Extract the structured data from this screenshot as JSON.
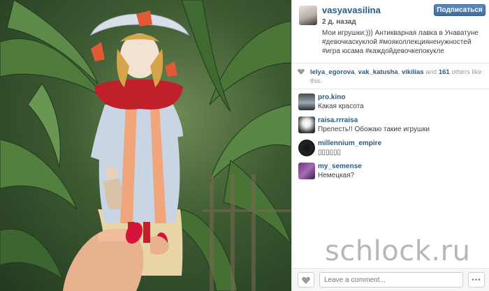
{
  "post": {
    "owner": "vasyavasilina",
    "follow_label": "Подписаться",
    "time": "2 д. назад",
    "caption": "Мои игрушки:))) Антикварная лавка в Унаватуне #девочкаскуклой #моя​коллекцияненужностей #игра юсама #каждойдевочкепокукле"
  },
  "likes": {
    "users": [
      "lelya_egorova",
      "vak_katusha",
      "vikilias"
    ],
    "sep1": ", ",
    "sep2": ", ",
    "and": " and ",
    "count": "161",
    "suffix": " others like this."
  },
  "comments": [
    {
      "user": "pro.kino",
      "text": "Какая красота"
    },
    {
      "user": "raisa.rrraisa",
      "text": "Прелесть!! Обожаю такие игрушки"
    },
    {
      "user": "millennium_empire",
      "text": "▯▯▯▯▯▯"
    },
    {
      "user": "my_semense",
      "text": "Немецкая?"
    }
  ],
  "footer": {
    "comment_placeholder": "Leave a comment...",
    "more_label": "•••"
  },
  "watermark": "schlock.ru",
  "colors": {
    "link": "#2a5b83",
    "follow_button": "#3f6f9e",
    "nail_polish": "#d4143a",
    "dress_collar": "#c0202a",
    "dress": "#c9d4e4"
  }
}
